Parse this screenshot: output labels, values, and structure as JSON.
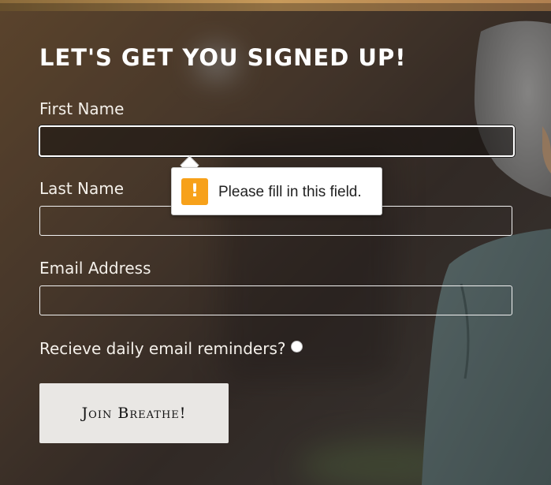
{
  "form": {
    "title": "LET'S GET YOU SIGNED UP!",
    "first_name_label": "First Name",
    "first_name_value": "",
    "last_name_label": "Last Name",
    "last_name_value": "",
    "email_label": "Email Address",
    "email_value": "",
    "reminders_label": "Recieve daily email reminders?",
    "reminders_checked": false,
    "submit_label": "Join Breathe!"
  },
  "validation_tooltip": {
    "icon": "warning-icon",
    "icon_glyph": "!",
    "message": "Please fill in this field."
  },
  "colors": {
    "warning": "#f7a11a",
    "button_bg": "#e9e7e4",
    "text": "#ffffff"
  }
}
